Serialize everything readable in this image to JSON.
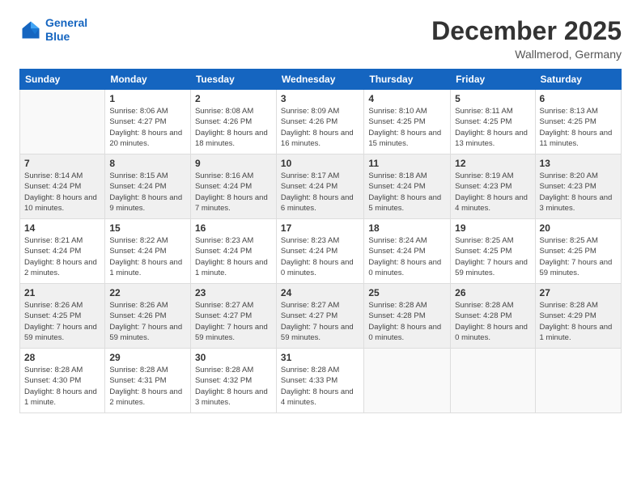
{
  "logo": {
    "line1": "General",
    "line2": "Blue"
  },
  "title": "December 2025",
  "location": "Wallmerod, Germany",
  "headers": [
    "Sunday",
    "Monday",
    "Tuesday",
    "Wednesday",
    "Thursday",
    "Friday",
    "Saturday"
  ],
  "weeks": [
    [
      {
        "day": "",
        "sunrise": "",
        "sunset": "",
        "daylight": ""
      },
      {
        "day": "1",
        "sunrise": "Sunrise: 8:06 AM",
        "sunset": "Sunset: 4:27 PM",
        "daylight": "Daylight: 8 hours and 20 minutes."
      },
      {
        "day": "2",
        "sunrise": "Sunrise: 8:08 AM",
        "sunset": "Sunset: 4:26 PM",
        "daylight": "Daylight: 8 hours and 18 minutes."
      },
      {
        "day": "3",
        "sunrise": "Sunrise: 8:09 AM",
        "sunset": "Sunset: 4:26 PM",
        "daylight": "Daylight: 8 hours and 16 minutes."
      },
      {
        "day": "4",
        "sunrise": "Sunrise: 8:10 AM",
        "sunset": "Sunset: 4:25 PM",
        "daylight": "Daylight: 8 hours and 15 minutes."
      },
      {
        "day": "5",
        "sunrise": "Sunrise: 8:11 AM",
        "sunset": "Sunset: 4:25 PM",
        "daylight": "Daylight: 8 hours and 13 minutes."
      },
      {
        "day": "6",
        "sunrise": "Sunrise: 8:13 AM",
        "sunset": "Sunset: 4:25 PM",
        "daylight": "Daylight: 8 hours and 11 minutes."
      }
    ],
    [
      {
        "day": "7",
        "sunrise": "Sunrise: 8:14 AM",
        "sunset": "Sunset: 4:24 PM",
        "daylight": "Daylight: 8 hours and 10 minutes."
      },
      {
        "day": "8",
        "sunrise": "Sunrise: 8:15 AM",
        "sunset": "Sunset: 4:24 PM",
        "daylight": "Daylight: 8 hours and 9 minutes."
      },
      {
        "day": "9",
        "sunrise": "Sunrise: 8:16 AM",
        "sunset": "Sunset: 4:24 PM",
        "daylight": "Daylight: 8 hours and 7 minutes."
      },
      {
        "day": "10",
        "sunrise": "Sunrise: 8:17 AM",
        "sunset": "Sunset: 4:24 PM",
        "daylight": "Daylight: 8 hours and 6 minutes."
      },
      {
        "day": "11",
        "sunrise": "Sunrise: 8:18 AM",
        "sunset": "Sunset: 4:24 PM",
        "daylight": "Daylight: 8 hours and 5 minutes."
      },
      {
        "day": "12",
        "sunrise": "Sunrise: 8:19 AM",
        "sunset": "Sunset: 4:23 PM",
        "daylight": "Daylight: 8 hours and 4 minutes."
      },
      {
        "day": "13",
        "sunrise": "Sunrise: 8:20 AM",
        "sunset": "Sunset: 4:23 PM",
        "daylight": "Daylight: 8 hours and 3 minutes."
      }
    ],
    [
      {
        "day": "14",
        "sunrise": "Sunrise: 8:21 AM",
        "sunset": "Sunset: 4:24 PM",
        "daylight": "Daylight: 8 hours and 2 minutes."
      },
      {
        "day": "15",
        "sunrise": "Sunrise: 8:22 AM",
        "sunset": "Sunset: 4:24 PM",
        "daylight": "Daylight: 8 hours and 1 minute."
      },
      {
        "day": "16",
        "sunrise": "Sunrise: 8:23 AM",
        "sunset": "Sunset: 4:24 PM",
        "daylight": "Daylight: 8 hours and 1 minute."
      },
      {
        "day": "17",
        "sunrise": "Sunrise: 8:23 AM",
        "sunset": "Sunset: 4:24 PM",
        "daylight": "Daylight: 8 hours and 0 minutes."
      },
      {
        "day": "18",
        "sunrise": "Sunrise: 8:24 AM",
        "sunset": "Sunset: 4:24 PM",
        "daylight": "Daylight: 8 hours and 0 minutes."
      },
      {
        "day": "19",
        "sunrise": "Sunrise: 8:25 AM",
        "sunset": "Sunset: 4:25 PM",
        "daylight": "Daylight: 7 hours and 59 minutes."
      },
      {
        "day": "20",
        "sunrise": "Sunrise: 8:25 AM",
        "sunset": "Sunset: 4:25 PM",
        "daylight": "Daylight: 7 hours and 59 minutes."
      }
    ],
    [
      {
        "day": "21",
        "sunrise": "Sunrise: 8:26 AM",
        "sunset": "Sunset: 4:25 PM",
        "daylight": "Daylight: 7 hours and 59 minutes."
      },
      {
        "day": "22",
        "sunrise": "Sunrise: 8:26 AM",
        "sunset": "Sunset: 4:26 PM",
        "daylight": "Daylight: 7 hours and 59 minutes."
      },
      {
        "day": "23",
        "sunrise": "Sunrise: 8:27 AM",
        "sunset": "Sunset: 4:27 PM",
        "daylight": "Daylight: 7 hours and 59 minutes."
      },
      {
        "day": "24",
        "sunrise": "Sunrise: 8:27 AM",
        "sunset": "Sunset: 4:27 PM",
        "daylight": "Daylight: 7 hours and 59 minutes."
      },
      {
        "day": "25",
        "sunrise": "Sunrise: 8:28 AM",
        "sunset": "Sunset: 4:28 PM",
        "daylight": "Daylight: 8 hours and 0 minutes."
      },
      {
        "day": "26",
        "sunrise": "Sunrise: 8:28 AM",
        "sunset": "Sunset: 4:28 PM",
        "daylight": "Daylight: 8 hours and 0 minutes."
      },
      {
        "day": "27",
        "sunrise": "Sunrise: 8:28 AM",
        "sunset": "Sunset: 4:29 PM",
        "daylight": "Daylight: 8 hours and 1 minute."
      }
    ],
    [
      {
        "day": "28",
        "sunrise": "Sunrise: 8:28 AM",
        "sunset": "Sunset: 4:30 PM",
        "daylight": "Daylight: 8 hours and 1 minute."
      },
      {
        "day": "29",
        "sunrise": "Sunrise: 8:28 AM",
        "sunset": "Sunset: 4:31 PM",
        "daylight": "Daylight: 8 hours and 2 minutes."
      },
      {
        "day": "30",
        "sunrise": "Sunrise: 8:28 AM",
        "sunset": "Sunset: 4:32 PM",
        "daylight": "Daylight: 8 hours and 3 minutes."
      },
      {
        "day": "31",
        "sunrise": "Sunrise: 8:28 AM",
        "sunset": "Sunset: 4:33 PM",
        "daylight": "Daylight: 8 hours and 4 minutes."
      },
      {
        "day": "",
        "sunrise": "",
        "sunset": "",
        "daylight": ""
      },
      {
        "day": "",
        "sunrise": "",
        "sunset": "",
        "daylight": ""
      },
      {
        "day": "",
        "sunrise": "",
        "sunset": "",
        "daylight": ""
      }
    ]
  ]
}
